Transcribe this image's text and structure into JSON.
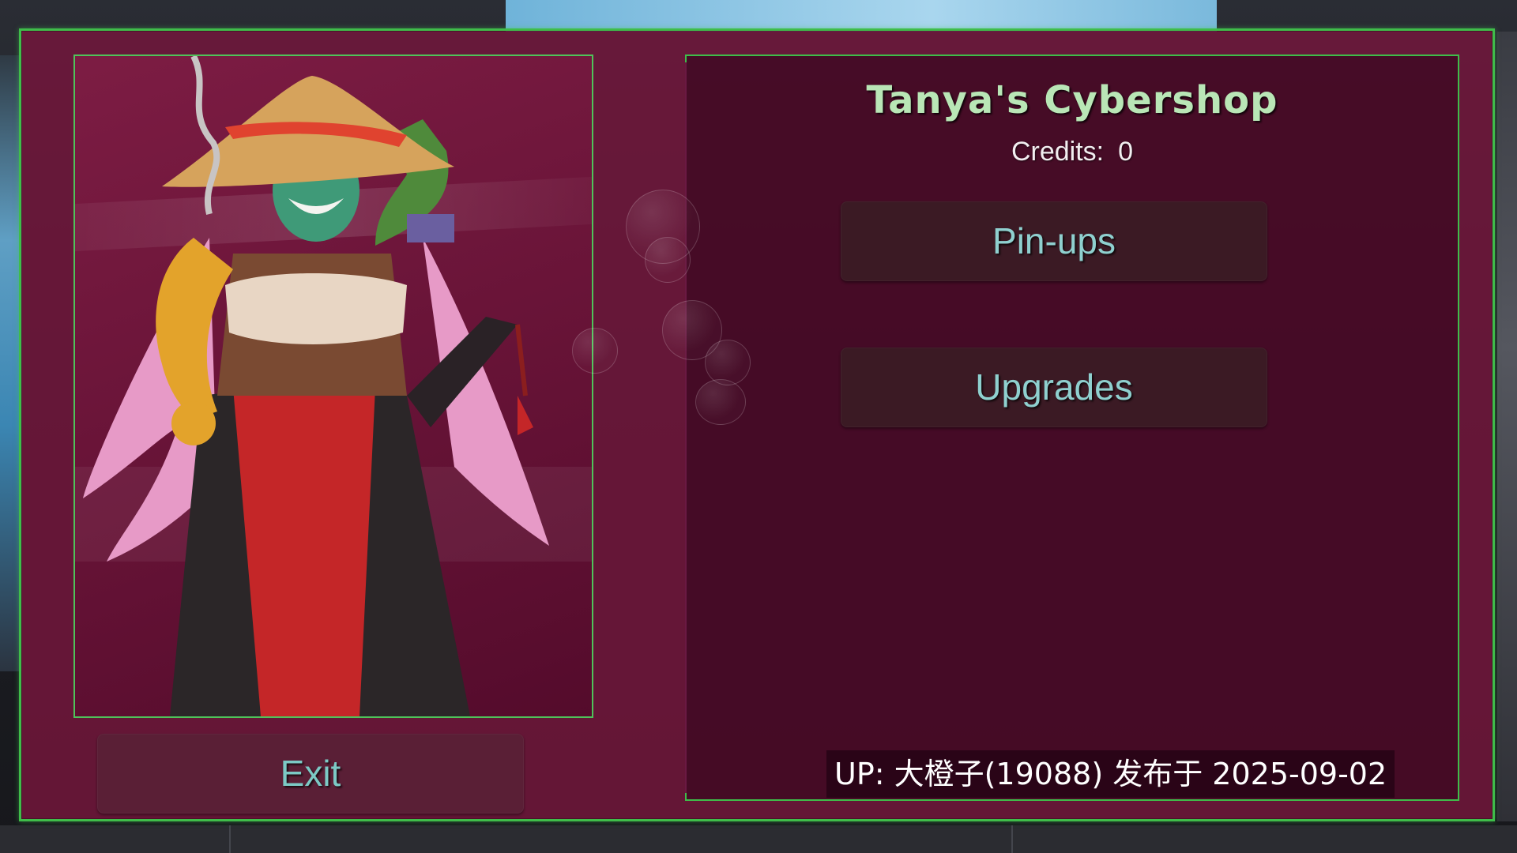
{
  "shop": {
    "title": "Tanya's Cybershop",
    "credits_label": "Credits:",
    "credits_value": "0"
  },
  "buttons": {
    "pinups_label": "Pin-ups",
    "upgrades_label": "Upgrades",
    "exit_label": "Exit"
  },
  "watermark": {
    "text": "UP: 大橙子(19088) 发布于 2025-09-02"
  },
  "colors": {
    "frame_border": "#3fbd4a",
    "panel_bg": "#74163c",
    "title_text": "#b9e6b6",
    "button_text": "#8fd0cf"
  },
  "portrait": {
    "icon": "character-portrait"
  }
}
